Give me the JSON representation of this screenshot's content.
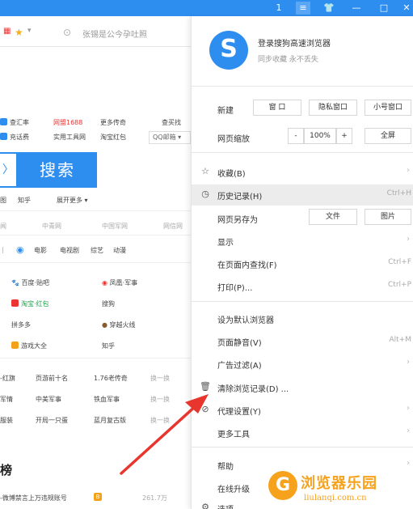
{
  "titlebar": {
    "buttons": [
      "1",
      "≡",
      "👕",
      "—",
      "□",
      "✕"
    ]
  },
  "addrbar": {
    "star_icon": "★",
    "sep": "▾",
    "text": "张锡是公今孕吐照"
  },
  "page": {
    "quick_links_row1": [
      "查汇率",
      "网盟1688",
      "更多传奇",
      "查买找"
    ],
    "quick_links_row2": [
      "充话费",
      "实用工具网",
      "淘宝红包"
    ],
    "select": "QQ邮箱 ▾",
    "search_prefix": "〉",
    "search_button": "搜索",
    "sub_links": [
      "图",
      "知乎",
      "展开更多 ▾"
    ],
    "nav_tabs": [
      "闻",
      "中青网",
      "中国军网",
      "网信网"
    ],
    "media": [
      "电影",
      "电视剧",
      "综艺",
      "动漫"
    ],
    "sites": [
      [
        "百度·贴吧",
        "凤凰·军事"
      ],
      [
        "淘宝·红包",
        "搜狗"
      ],
      [
        "拼多多",
        "穿越火线"
      ],
      [
        "游戏大全",
        "知乎"
      ]
    ],
    "hot_rows": [
      [
        "-红旗",
        "页游前十名",
        "1.76老传奇",
        "换一换"
      ],
      [
        "军情",
        "中美军事",
        "铁血军事",
        "换一换"
      ],
      [
        "服装",
        "开局一只蛋",
        "蓝月复古版",
        "换一换"
      ]
    ],
    "heading": "榜",
    "bottom_item": "-微博禁言上万违规账号",
    "bottom_badge": "B",
    "bottom_count": "261.7万"
  },
  "menu": {
    "logo": "S",
    "login_title": "登录搜狗高速浏览器",
    "login_sub": "同步收藏 永不丢失",
    "new_label": "新建",
    "new_buttons": [
      "窗 口",
      "隐私窗口",
      "小号窗口"
    ],
    "zoom_label": "网页缩放",
    "zoom_minus": "-",
    "zoom_value": "100%",
    "zoom_plus": "+",
    "fullscreen": "全屏",
    "items": [
      {
        "icon": "☆",
        "label": "收藏(B)",
        "shortcut": "",
        "arrow": "›"
      },
      {
        "icon": "◷",
        "label": "历史记录(H)",
        "shortcut": "Ctrl+H",
        "arrow": ""
      },
      {
        "icon": "",
        "label": "网页另存为",
        "shortcut": "",
        "arrow": ""
      },
      {
        "icon": "",
        "label": "显示",
        "shortcut": "",
        "arrow": "›"
      },
      {
        "icon": "",
        "label": "在页面内查找(F)",
        "shortcut": "Ctrl+F",
        "arrow": ""
      },
      {
        "icon": "",
        "label": "打印(P)...",
        "shortcut": "Ctrl+P",
        "arrow": ""
      },
      {
        "icon": "",
        "label": "设为默认浏览器",
        "shortcut": "",
        "arrow": ""
      },
      {
        "icon": "",
        "label": "页面静音(V)",
        "shortcut": "Alt+M",
        "arrow": ""
      },
      {
        "icon": "",
        "label": "广告过滤(A)",
        "shortcut": "",
        "arrow": "›"
      },
      {
        "icon": "🗑",
        "label": "清除浏览记录(D) ...",
        "shortcut": "",
        "arrow": ""
      },
      {
        "icon": "⊘",
        "label": "代理设置(Y)",
        "shortcut": "",
        "arrow": "›"
      },
      {
        "icon": "",
        "label": "更多工具",
        "shortcut": "",
        "arrow": "›"
      },
      {
        "icon": "",
        "label": "帮助",
        "shortcut": "",
        "arrow": "›"
      },
      {
        "icon": "",
        "label": "在线升级",
        "shortcut": "",
        "arrow": ""
      },
      {
        "icon": "⚙",
        "label": "选项",
        "shortcut": "",
        "arrow": ""
      }
    ],
    "saveas_buttons": [
      "文件",
      "图片"
    ]
  },
  "watermark": {
    "logo": "G",
    "title": "浏览器乐园",
    "url": "liulanqi.com.cn"
  },
  "colors": {
    "accent": "#2e8ef0",
    "arrow": "#e8352e",
    "watermark": "#f7a21c"
  }
}
